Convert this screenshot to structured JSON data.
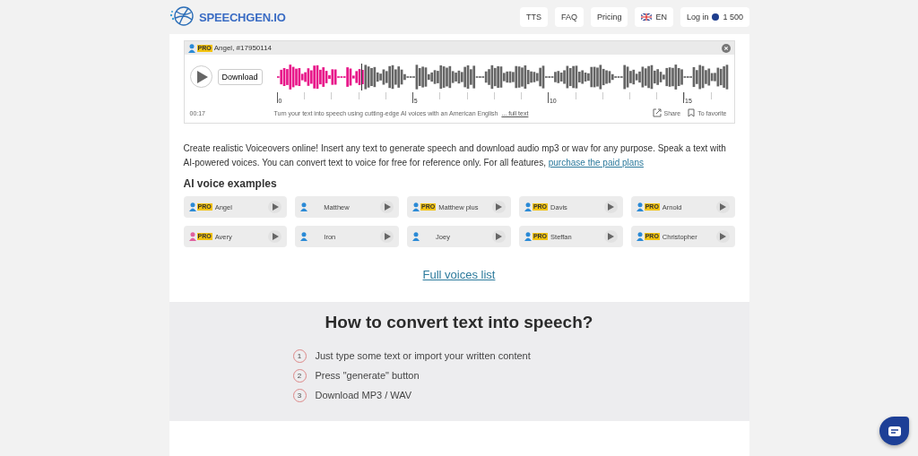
{
  "header": {
    "logo": "SPEECHGEN.IO",
    "nav": [
      {
        "label": "TTS",
        "kind": "plain"
      },
      {
        "label": "FAQ",
        "kind": "plain"
      },
      {
        "label": "Pricing",
        "kind": "plain"
      },
      {
        "label": "EN",
        "kind": "flag"
      },
      {
        "label": "Log in",
        "kind": "login",
        "balance": "1 500"
      }
    ]
  },
  "player": {
    "title": "Angel, #17950114",
    "badge": "PRO",
    "download": "Download",
    "level": 0.19,
    "ticks": [
      "0",
      "5",
      "10",
      "15"
    ],
    "time": "00:17",
    "caption": "Turn your text into speech using cutting-edge AI voices with an American English",
    "full_text": "... full text",
    "share": "Share",
    "favorite": "To favorite"
  },
  "intro": {
    "text": "Create realistic Voiceovers online! Insert any text to generate speech and download audio mp3 or wav for any purpose. Speak a text with AI-powered voices. You can convert text to voice for free for reference only. For all features,",
    "link": "purchase the paid plans"
  },
  "voices_heading": "AI voice examples",
  "voices": [
    {
      "name": "Angel",
      "badge": "PRO",
      "color": "#2b8ad6"
    },
    {
      "name": "Matthew",
      "color": "#2b8ad6"
    },
    {
      "name": "Matthew plus",
      "badge": "PRO",
      "color": "#2b8ad6"
    },
    {
      "name": "Davis",
      "badge": "PRO",
      "color": "#2b8ad6"
    },
    {
      "name": "Arnold",
      "badge": "PRO",
      "color": "#2b8ad6"
    },
    {
      "name": "Avery",
      "badge": "PRO",
      "color": "#e0609e"
    },
    {
      "name": "Iron",
      "color": "#2b8ad6"
    },
    {
      "name": "Joey",
      "color": "#2b8ad6"
    },
    {
      "name": "Steffan",
      "badge": "PRO",
      "color": "#2b8ad6"
    },
    {
      "name": "Christopher",
      "badge": "PRO",
      "color": "#2b8ad6"
    }
  ],
  "full_list_link": "Full voices list",
  "howto": {
    "title": "How to convert text into speech?",
    "steps": [
      {
        "number": "1",
        "text": "Just type some text or import your written content"
      },
      {
        "number": "2",
        "text": "Press \"generate\" button"
      },
      {
        "number": "3",
        "text": "Download MP3 / WAV"
      }
    ]
  }
}
